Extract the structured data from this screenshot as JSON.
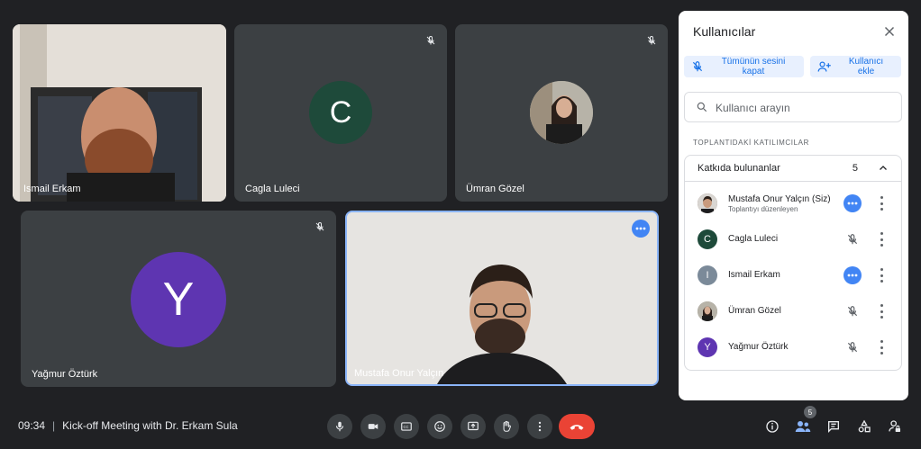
{
  "tiles": [
    {
      "name": "Ismail Erkam"
    },
    {
      "name": "Cagla Luleci",
      "initial": "C",
      "color": "#1e4a3a"
    },
    {
      "name": "Ümran Gözel"
    },
    {
      "name": "Yağmur Öztürk",
      "initial": "Y",
      "color": "#5e35b1"
    },
    {
      "name": "Mustafa Onur Yalçın"
    }
  ],
  "bottom_bar": {
    "time": "09:34",
    "separator": "|",
    "meeting_title": "Kick-off Meeting with Dr. Erkam Sula",
    "people_count": "5",
    "end_call_color": "#ea4335"
  },
  "panel": {
    "title": "Kullanıcılar",
    "mute_all_label": "Tümünün sesini kapat",
    "add_people_label": "Kullanıcı ekle",
    "search_placeholder": "Kullanıcı arayın",
    "section_label": "TOPLANTIDAKİ KATILIMCILAR",
    "group_title": "Katkıda bulunanlar",
    "group_count": "5",
    "participants": [
      {
        "name": "Mustafa Onur Yalçın (Siz)",
        "subtitle": "Toplantıyı düzenleyen",
        "status": "speaking"
      },
      {
        "name": "Cagla Luleci",
        "initial": "C",
        "color": "#1e4a3a",
        "status": "muted"
      },
      {
        "name": "Ismail Erkam",
        "initial": "I",
        "color": "#7b8a99",
        "status": "speaking"
      },
      {
        "name": "Ümran Gözel",
        "status": "muted"
      },
      {
        "name": "Yağmur Öztürk",
        "initial": "Y",
        "color": "#5e35b1",
        "status": "muted"
      }
    ]
  }
}
